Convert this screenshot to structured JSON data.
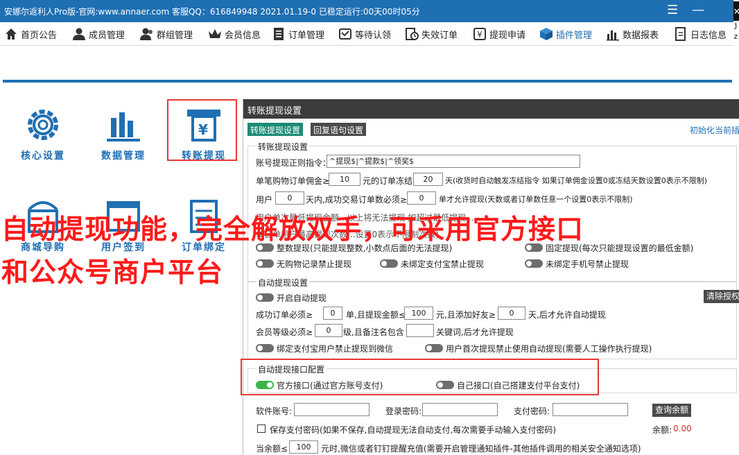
{
  "window": {
    "title": "安娜尔返利人Pro版-官网:www.annaer.com 客服QQ：616849948  2021.01.19-0  已稳定运行:00天00时05分"
  },
  "menu": [
    {
      "label": "首页公告",
      "icon": "home-icon"
    },
    {
      "label": "成员管理",
      "icon": "user-icon"
    },
    {
      "label": "群组管理",
      "icon": "group-icon"
    },
    {
      "label": "会员信息",
      "icon": "crown-icon"
    },
    {
      "label": "订单管理",
      "icon": "list-icon"
    },
    {
      "label": "等待认领",
      "icon": "stamp-icon"
    },
    {
      "label": "失效订单",
      "icon": "clock-doc-icon"
    },
    {
      "label": "提现申请",
      "icon": "yen-icon"
    },
    {
      "label": "插件管理",
      "icon": "cube-icon",
      "active": true
    },
    {
      "label": "数据报表",
      "icon": "bars-icon"
    },
    {
      "label": "日志信息",
      "icon": "doc-icon"
    }
  ],
  "right_strip": [
    "v",
    "j",
    "z"
  ],
  "left_panel": {
    "items": [
      {
        "label": "核心设置",
        "icon": "gear-icon"
      },
      {
        "label": "数据管理",
        "icon": "database-icon"
      },
      {
        "label": "转账提现",
        "icon": "atm-icon"
      },
      {
        "label": "商城导购",
        "icon": "shop-icon"
      },
      {
        "label": "用户签到",
        "icon": "calendar-icon"
      },
      {
        "label": "订单绑定",
        "icon": "order-icon"
      }
    ]
  },
  "overlay": {
    "line1": "自动提现功能，完全解放双手，可采用官方接口",
    "line2": "和公众号商户平台"
  },
  "dialog": {
    "title": "转账提现设置",
    "tabs": [
      "转账提现设置",
      "回复语句设置"
    ],
    "init_link": "初始化当前插",
    "group1": {
      "legend": "转账提现设置",
      "regex_label": "账号提现正则指令：",
      "regex_value": "^提现$|^提款$|^领奖$",
      "row2_pre": "单笔购物订单佣金≥",
      "row2_val1": "10",
      "row2_mid": "元的订单冻结",
      "row2_val2": "20",
      "row2_post": "天(收货时自动触发冻结指令 如果订单佣金设置0或冻结天数设置0表示不限制)",
      "row3_pre": "用户",
      "row3_val1": "0",
      "row3_mid": "天内,成功交易订单数必须≥",
      "row3_val2": "0",
      "row3_post": "单才允许提现(天数或者订单数任意一个设置0表示不限制)",
      "row4_text": "用户单次最低提现金额...以上将无法提现 如超过最低提现...",
      "row5_text": "单日单用户最高提现次数...设置0表示不限制次数)",
      "toggles": [
        {
          "label": "整数提现(只能提现整数,小数点后面的无法提现)",
          "on": false
        },
        {
          "label": "固定提现(每次只能提现设置的最低金额)",
          "on": false
        },
        {
          "label": "无购物记录禁止提现",
          "on": false
        },
        {
          "label": "未绑定支付宝禁止提现",
          "on": false
        },
        {
          "label": "未绑定手机号禁止提现",
          "on": false
        }
      ]
    },
    "group2": {
      "legend": "自动提现设置",
      "auto_toggle": "开启自动提现",
      "clear_button": "清除授权",
      "row1_pre": "成功订单必须≥",
      "row1_val1": "0",
      "row1_mid1": "单,且提现金额≤",
      "row1_val2": "100",
      "row1_mid2": "元,且添加好友≥",
      "row1_val3": "0",
      "row1_post": "天,后才允许自动提现",
      "row2_pre": "会员等级必须≥",
      "row2_val1": "0",
      "row2_mid": "级,且备注名包含",
      "row2_val2": "",
      "row2_post": "关键词,后才允许提现",
      "toggle_wechat": "绑定支付宝用户禁止提现到微信",
      "toggle_first": "用户首次提现禁止使用自动提现(需要人工操作执行提现)"
    },
    "group3": {
      "legend": "自动提现接口配置",
      "opt_official": "官方接口(通过官方账号支付)",
      "opt_self": "自己接口(自己搭建支付平台支付)"
    },
    "account": {
      "software_label": "软件账号:",
      "login_label": "登录密码:",
      "pay_label": "支付密码:",
      "query_button": "查询余额",
      "save_label": "保存支付密码(如果不保存,自动提现无法自动支付,每次需要手动输入支付密码)",
      "balance_label": "余额:",
      "balance_value": "0.00",
      "threshold_pre": "当余额≤",
      "threshold_val": "100",
      "threshold_post": "元时,微信或者钉钉提醒充值(需要开启管理通知插件-其他插件调用的相关安全通知选项)"
    }
  }
}
